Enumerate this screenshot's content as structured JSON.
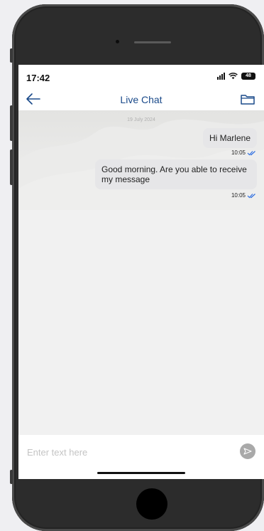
{
  "status_bar": {
    "time": "17:42",
    "battery_label": "48",
    "icons": [
      "signal-icon",
      "wifi-icon",
      "battery-icon"
    ]
  },
  "header": {
    "title": "Live Chat",
    "back_icon": "arrow-left-icon",
    "attachment_icon": "folder-icon"
  },
  "chat": {
    "date_label": "19 July 2024",
    "messages": [
      {
        "text": "Hi Marlene",
        "time": "10:05",
        "status": "read"
      },
      {
        "text": "Good morning. Are you able to receive my message",
        "time": "10:05",
        "status": "read"
      }
    ]
  },
  "composer": {
    "placeholder": "Enter text here",
    "value": "",
    "send_icon": "send-icon"
  },
  "colors": {
    "title": "#1a4a8a",
    "read_tick": "#2f6fe0",
    "bubble": "#e6e6e8",
    "chat_bg": "#f1f1f1"
  }
}
